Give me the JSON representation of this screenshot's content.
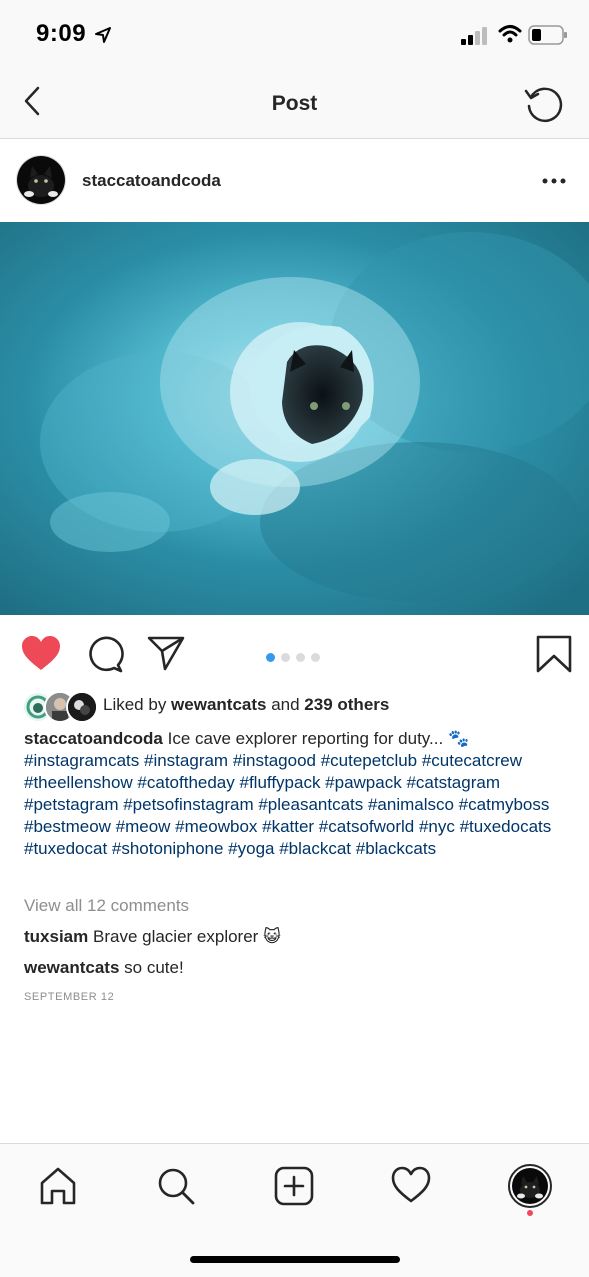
{
  "status_bar": {
    "time": "9:09"
  },
  "header": {
    "title": "Post"
  },
  "post": {
    "username": "staccatoandcoda",
    "carousel_pages": 4,
    "carousel_active": 1
  },
  "likes": {
    "prefix": "Liked by ",
    "user": "wewantcats",
    "middle": " and ",
    "count": "239 others"
  },
  "caption": {
    "username": "staccatoandcoda",
    "text": "Ice cave explorer reporting for duty...",
    "emoji": "🐾",
    "hashtags": "#instagramcats #instagram #instagood #cutepetclub #cutecatcrew #theellenshow #catoftheday #fluffypack #pawpack #catstagram #petstagram #petsofinstagram #pleasantcats #animalsco #catmyboss #bestmeow #meow #meowbox #katter #catsofworld #nyc #tuxedocats #tuxedocat #shotoniphone #yoga #blackcat #blackcats"
  },
  "view_comments": "View all 12 comments",
  "comments": [
    {
      "user": "tuxsiam",
      "text": "Brave glacier explorer",
      "emoji": "😺"
    },
    {
      "user": "wewantcats",
      "text": "so cute!"
    }
  ],
  "date": "SEPTEMBER 12",
  "colors": {
    "like_red": "#ed4956",
    "hashtag_blue": "#003569",
    "dot_active": "#3897f0"
  }
}
